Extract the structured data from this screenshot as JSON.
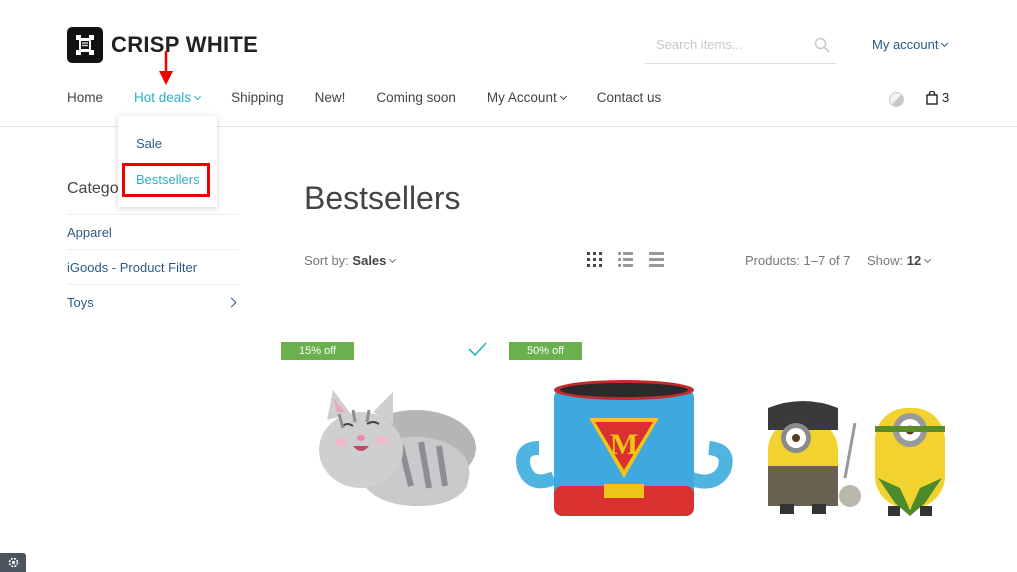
{
  "brand": {
    "name": "CRISP WHITE"
  },
  "search": {
    "placeholder": "Search items..."
  },
  "account_menu": {
    "label": "My account"
  },
  "nav": {
    "items": [
      {
        "label": "Home"
      },
      {
        "label": "Hot deals",
        "has_dropdown": true,
        "active": true
      },
      {
        "label": "Shipping"
      },
      {
        "label": "New!"
      },
      {
        "label": "Coming soon"
      },
      {
        "label": "My Account",
        "has_dropdown": true
      },
      {
        "label": "Contact us"
      }
    ]
  },
  "cart": {
    "count": "3"
  },
  "dropdown": {
    "items": [
      {
        "label": "Sale"
      },
      {
        "label": "Bestsellers"
      }
    ]
  },
  "sidebar": {
    "title": "Catego",
    "items": [
      {
        "label": "Apparel"
      },
      {
        "label": "iGoods - Product Filter"
      },
      {
        "label": "Toys",
        "has_children": true
      }
    ]
  },
  "main": {
    "title": "Bestsellers",
    "sort_label": "Sort by:",
    "sort_value": "Sales",
    "products_count": "Products: 1–7 of 7",
    "show_label": "Show:",
    "show_value": "12"
  },
  "products": [
    {
      "badge": "15% off",
      "icon": "plush-cat",
      "selected": true
    },
    {
      "badge": "50% off",
      "icon": "superhero-mug"
    },
    {
      "badge": "",
      "icon": "minion-figures"
    }
  ],
  "colors": {
    "accent": "#2ab0c8",
    "link": "#2b5b86",
    "badge": "#6ab04c",
    "annotation": "#e00000"
  }
}
